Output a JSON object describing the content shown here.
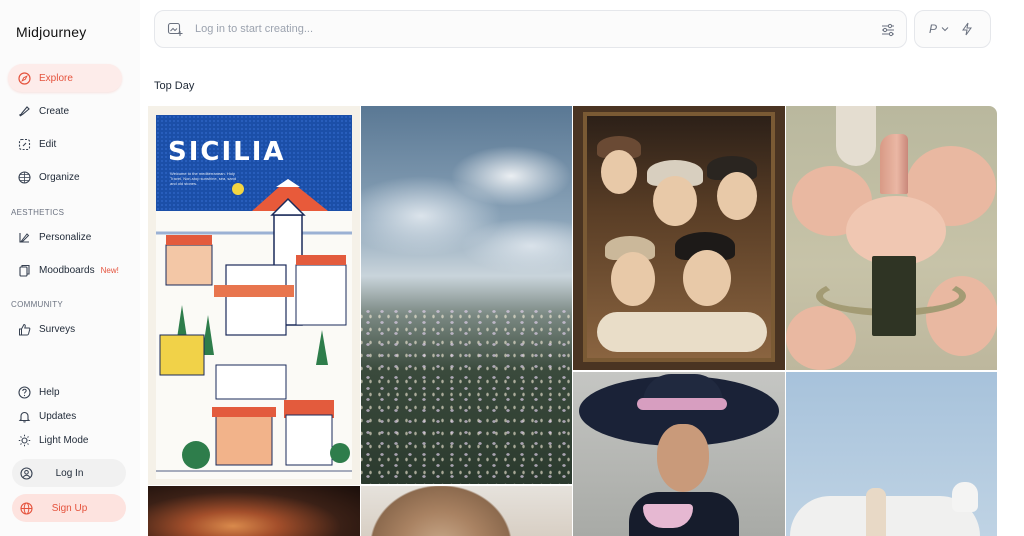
{
  "app": {
    "title": "Midjourney"
  },
  "sidebar": {
    "nav": [
      {
        "label": "Explore",
        "icon": "compass-icon",
        "active": true
      },
      {
        "label": "Create",
        "icon": "brush-icon"
      },
      {
        "label": "Edit",
        "icon": "edit-icon"
      },
      {
        "label": "Organize",
        "icon": "grid-icon"
      }
    ],
    "aesthetics_label": "AESTHETICS",
    "aesthetics": [
      {
        "label": "Personalize",
        "icon": "personalize-icon"
      },
      {
        "label": "Moodboards",
        "icon": "moodboard-icon",
        "badge": "New!"
      }
    ],
    "community_label": "COMMUNITY",
    "community": [
      {
        "label": "Surveys",
        "icon": "thumbs-up-icon"
      }
    ],
    "bottom": [
      {
        "label": "Help",
        "icon": "help-icon"
      },
      {
        "label": "Updates",
        "icon": "bell-icon"
      },
      {
        "label": "Light Mode",
        "icon": "sun-icon"
      }
    ],
    "login_label": "Log In",
    "signup_label": "Sign Up"
  },
  "prompt": {
    "placeholder": "Log in to start creating..."
  },
  "speed": {
    "label": "P"
  },
  "main": {
    "section_title": "Top Day"
  },
  "gallery": {
    "poster_title": "SICILIA",
    "poster_subtitle": "Welcome to the mediterranean. Holy Travel. Non-stop sunshine, sea, sand and old stones."
  },
  "colors": {
    "accent": "#e5533d",
    "accent_bg": "#fdecea"
  }
}
